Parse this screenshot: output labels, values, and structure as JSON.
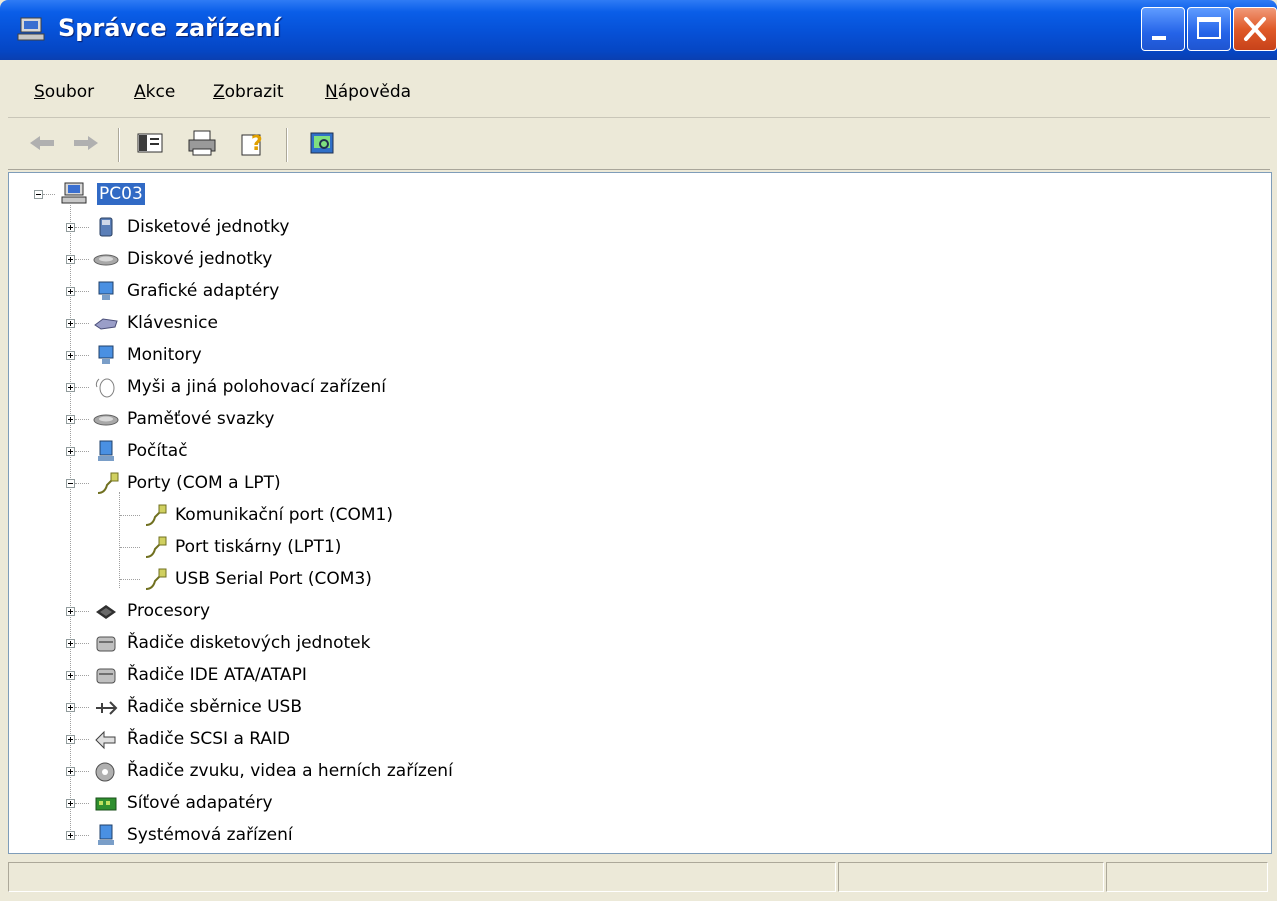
{
  "window": {
    "title": "Správce zařízení"
  },
  "menu": [
    {
      "key": "S",
      "rest": "oubor"
    },
    {
      "key": "A",
      "rest": "kce"
    },
    {
      "key": "Z",
      "rest": "obrazit"
    },
    {
      "key": "N",
      "rest": "ápověda"
    }
  ],
  "tree": {
    "root": "PC03",
    "categories": [
      "Disketové jednotky",
      "Diskové jednotky",
      "Grafické adaptéry",
      "Klávesnice",
      "Monitory",
      "Myši a jiná polohovací zařízení",
      "Paměťové svazky",
      "Počítač",
      "Porty (COM a LPT)",
      "Procesory",
      "Řadiče disketových jednotek",
      "Řadiče IDE ATA/ATAPI",
      "Řadiče sběrnice USB",
      "Řadiče SCSI a RAID",
      "Řadiče zvuku, videa a herních zařízení",
      "Síťové adapatéry",
      "Systémová zařízení"
    ],
    "ports_children": [
      "Komunikační port (COM1)",
      "Port tiskárny (LPT1)",
      "USB Serial Port (COM3)"
    ]
  },
  "colors": {
    "selection": "#316ac5",
    "titlebar": "#0a5ee8"
  }
}
